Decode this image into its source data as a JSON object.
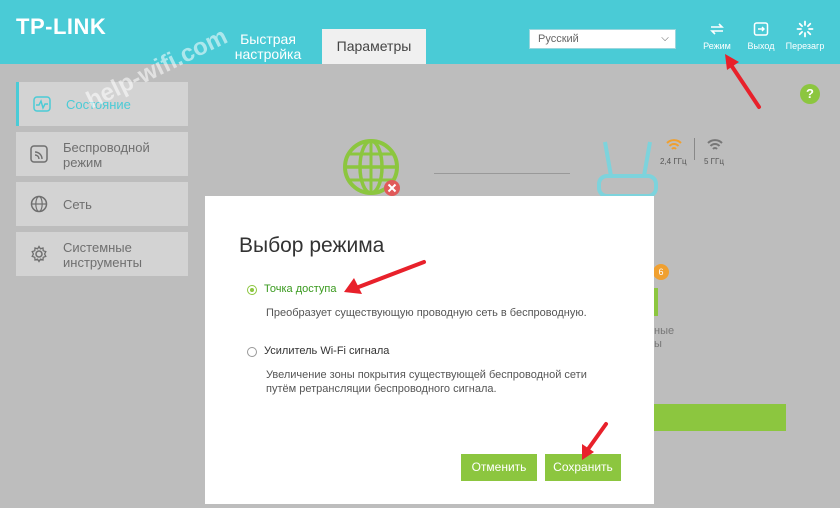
{
  "header": {
    "logo": "TP-LINK",
    "tabs": {
      "quick_setup": "Быстрая настройка",
      "parameters": "Параметры"
    },
    "language": "Русский",
    "buttons": {
      "mode": "Режим",
      "logout": "Выход",
      "reboot": "Перезагр"
    }
  },
  "sidebar": {
    "items": [
      {
        "label": "Состояние",
        "icon": "status-icon",
        "active": true
      },
      {
        "label": "Беспроводной режим",
        "icon": "wireless-icon"
      },
      {
        "label": "Сеть",
        "icon": "globe-icon"
      },
      {
        "label": "Системные инструменты",
        "icon": "gear-icon"
      }
    ]
  },
  "watermark": "help-wifi.com",
  "status": {
    "band_24": "2,4 ГГц",
    "band_5": "5 ГГц",
    "badge": "6",
    "partial_text": "ные\nы"
  },
  "dialog": {
    "title": "Выбор режима",
    "options": [
      {
        "label": "Точка доступа",
        "description": "Преобразует существующую проводную сеть в беспроводную.",
        "selected": true
      },
      {
        "label": "Усилитель Wi-Fi сигнала",
        "description": "Увеличение зоны покрытия существующей беспроводной сети путём ретрансляции беспроводного сигнала.",
        "selected": false
      }
    ],
    "cancel_label": "Отменить",
    "save_label": "Сохранить"
  },
  "colors": {
    "header": "#4acbd6",
    "accent_green": "#8cc63f",
    "annotation_red": "#e8212b",
    "wifi_orange": "#f0a030"
  }
}
